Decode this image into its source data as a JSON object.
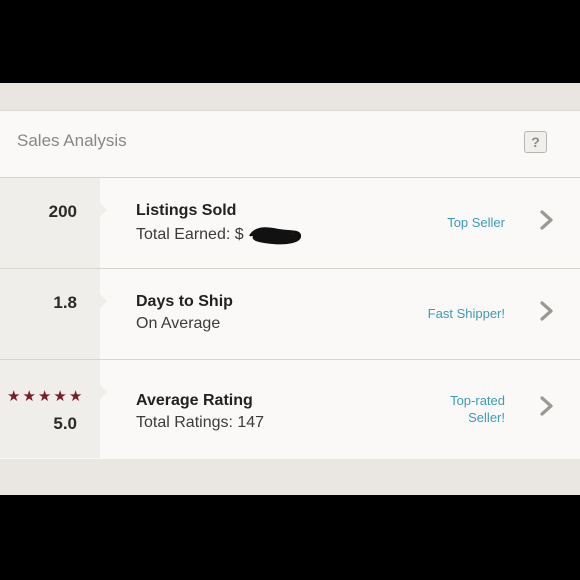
{
  "section": {
    "title": "Sales Analysis",
    "help_label": "?"
  },
  "rows": [
    {
      "value": "200",
      "title": "Listings Sold",
      "subtitle": "Total Earned: $",
      "badge": "Top Seller"
    },
    {
      "value": "1.8",
      "title": "Days to Ship",
      "subtitle": "On Average",
      "badge": "Fast Shipper!"
    },
    {
      "value": "5.0",
      "stars": 5,
      "title": "Average Rating",
      "subtitle": "Total Ratings: 147",
      "badge_line1": "Top-rated",
      "badge_line2": "Seller!"
    }
  ],
  "icons": {
    "help": "question-mark-icon",
    "row_arrow": "chevron-right-icon",
    "rating": "star-icon",
    "redaction": "scribble-redaction"
  },
  "colors": {
    "accent_link": "#3e9bb5",
    "star": "#7a1c29"
  }
}
